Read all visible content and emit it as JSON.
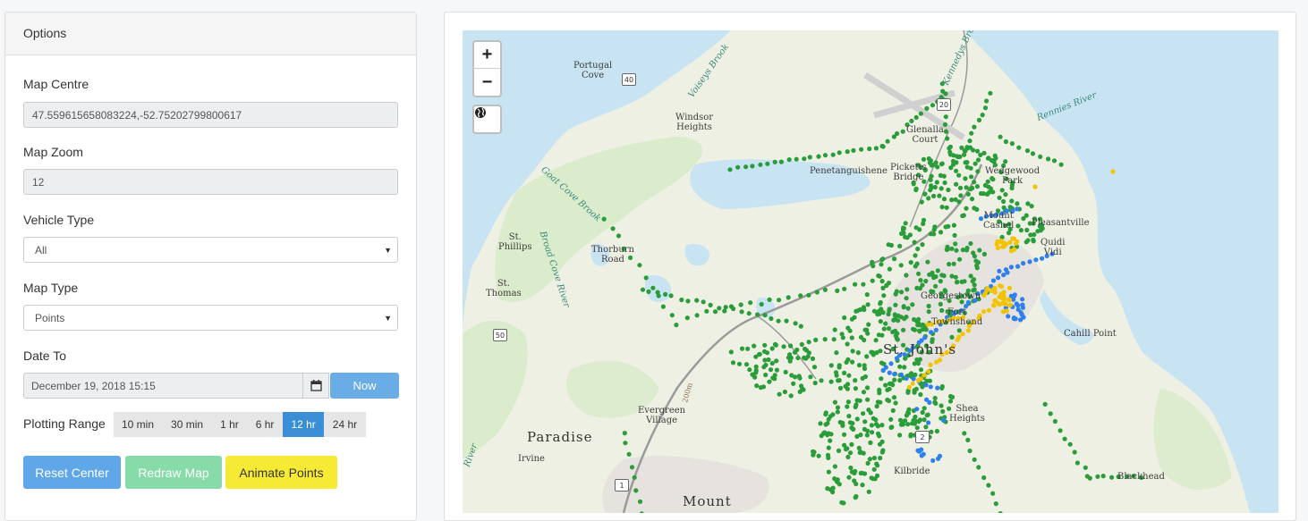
{
  "options": {
    "title": "Options",
    "map_centre_label": "Map Centre",
    "map_centre_value": "47.559615658083224,-52.75202799800617",
    "map_zoom_label": "Map Zoom",
    "map_zoom_value": "12",
    "vehicle_type_label": "Vehicle Type",
    "vehicle_type_value": "All",
    "map_type_label": "Map Type",
    "map_type_value": "Points",
    "date_to_label": "Date To",
    "date_to_value": "December 19, 2018 15:15",
    "now_label": "Now",
    "plotting_range_label": "Plotting Range",
    "ranges": [
      "10 min",
      "30 min",
      "1 hr",
      "6 hr",
      "12 hr",
      "24 hr"
    ],
    "active_range": "12 hr",
    "reset_center_label": "Reset Center",
    "redraw_map_label": "Redraw Map",
    "animate_points_label": "Animate Points"
  },
  "map": {
    "zoom_in": "+",
    "zoom_out": "−",
    "place_labels": {
      "portugal_cove": "Portugal\nCove",
      "windsor_heights": "Windsor\nHeights",
      "glencoe_court": "Glenalla\nCourt",
      "penetanguishene": "Penetanguishene",
      "pickets_bridge": "Picketts\nBridge",
      "wedgewood_park": "Wedgewood\nPark",
      "st_phillips": "St.\nPhillips",
      "thorburn_road": "Thorburn\nRoad",
      "mount_cashel": "Mount\nCashel",
      "pleasantville": "Pleasantville",
      "quidi_vidi": "Quidi\nVidi",
      "st_thomas": "St.\nThomas",
      "georgestown": "Georgestown",
      "fort_townshend": "Fort\nTownshend",
      "st_johns": "St. John's",
      "cahill_point": "Cahill Point",
      "evergreen_village": "Evergreen\nVillage",
      "shea_heights": "Shea\nHeights",
      "paradise": "Paradise",
      "irvine": "Irvine",
      "kilbride": "Kilbride",
      "blackhead": "Blackhead",
      "mount": "Mount",
      "voiseys_brook": "Voiseys Brook",
      "gout_cove_brook": "Goat Cove Brook",
      "broad_cove_river": "Broad Cove River",
      "rennies_river": "Rennies River",
      "kennedys_brook": "Kennedys Brook",
      "river": "River",
      "elevation": "200m"
    },
    "route_shields": [
      "40",
      "20",
      "50",
      "2",
      "1"
    ],
    "legend_colors": {
      "green": "#2a9d3a",
      "blue": "#2f80ed",
      "yellow": "#f2c300"
    }
  }
}
